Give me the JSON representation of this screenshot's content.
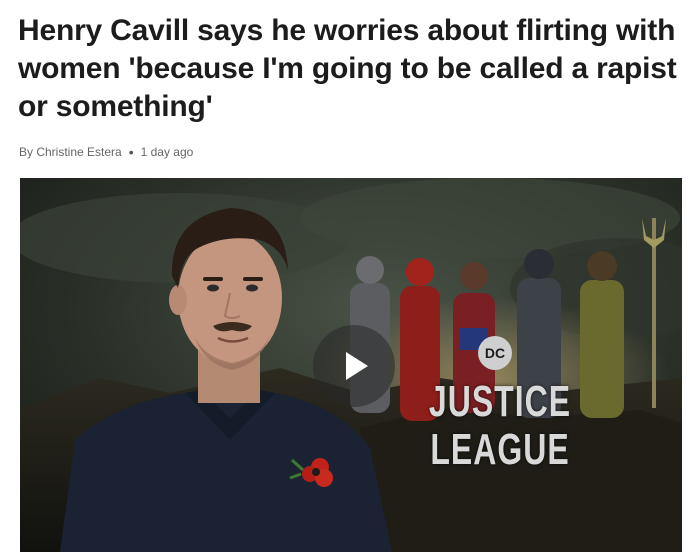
{
  "article": {
    "headline": "Henry Cavill says he worries about flirting with women 'because I'm going to be called a rapist or something'",
    "byline": {
      "author": "By Christine Estera",
      "separator": "•",
      "time": "1 day ago"
    }
  },
  "video": {
    "logo": {
      "badge": "DC",
      "line1": "JUSTICE",
      "line2": "LEAGUE"
    },
    "play_icon": "play-icon",
    "colors": {
      "background": "#1b1f1a",
      "shirt": "#1a2233",
      "poppy": "#c0231b"
    }
  }
}
